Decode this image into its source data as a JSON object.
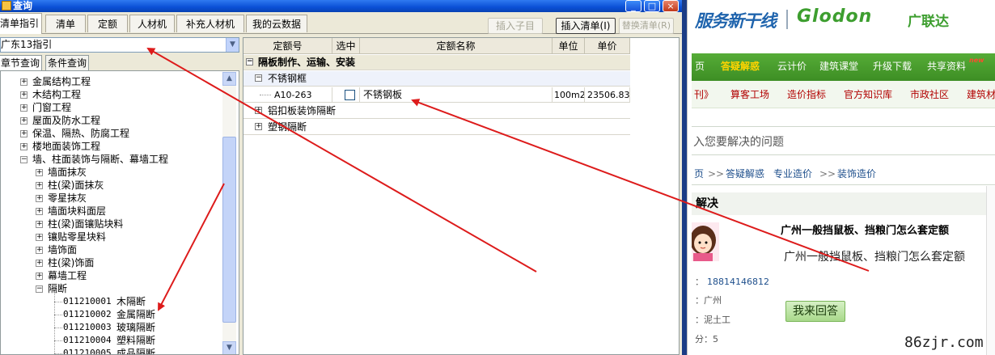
{
  "window": {
    "title": "查询",
    "buttons": {
      "minimize": "_",
      "maximize": "□",
      "close": "×"
    }
  },
  "tabs": [
    "清单指引",
    "清单",
    "定额",
    "人材机",
    "补充人材机",
    "我的云数据"
  ],
  "toolbar": {
    "insert_child": "插入子目",
    "insert_list": "插入清单(I)",
    "replace_list": "替换清单(R)"
  },
  "left_panel": {
    "combo_value": "广东13指引",
    "subtabs": [
      "章节查询",
      "条件查询"
    ],
    "tree": [
      {
        "label": "金属结构工程",
        "expander": "+"
      },
      {
        "label": "木结构工程",
        "expander": "+"
      },
      {
        "label": "门窗工程",
        "expander": "+"
      },
      {
        "label": "屋面及防水工程",
        "expander": "+"
      },
      {
        "label": "保温、隔热、防腐工程",
        "expander": "+"
      },
      {
        "label": "楼地面装饰工程",
        "expander": "+"
      },
      {
        "label": "墙、柱面装饰与隔断、幕墙工程",
        "expander": "−"
      },
      {
        "label": "墙面抹灰",
        "expander": "+"
      },
      {
        "label": "柱(梁)面抹灰",
        "expander": "+"
      },
      {
        "label": "零星抹灰",
        "expander": "+"
      },
      {
        "label": "墙面块料面层",
        "expander": "+"
      },
      {
        "label": "柱(梁)面镶贴块料",
        "expander": "+"
      },
      {
        "label": "镶贴零星块料",
        "expander": "+"
      },
      {
        "label": "墙饰面",
        "expander": "+"
      },
      {
        "label": "柱(梁)饰面",
        "expander": "+"
      },
      {
        "label": "幕墙工程",
        "expander": "+"
      },
      {
        "label": "隔断",
        "expander": "−"
      }
    ],
    "leaf_items": [
      {
        "code": "011210001",
        "name": "木隔断"
      },
      {
        "code": "011210002",
        "name": "金属隔断"
      },
      {
        "code": "011210003",
        "name": "玻璃隔断"
      },
      {
        "code": "011210004",
        "name": "塑料隔断"
      },
      {
        "code": "011210005",
        "name": "成品隔断"
      }
    ]
  },
  "grid": {
    "columns": [
      "定额号",
      "选中",
      "定额名称",
      "单位",
      "单价"
    ],
    "group": {
      "label": "隔板制作、运输、安装",
      "expander": "−"
    },
    "sub_groups": [
      {
        "label": "不锈钢框",
        "expander": "−"
      },
      {
        "label": "铝扣板装饰隔断",
        "expander": "+"
      },
      {
        "label": "塑钢隔断",
        "expander": "+"
      }
    ],
    "row": {
      "code": "A10-263",
      "name": "不锈钢板",
      "unit": "100m2",
      "price": "23506.83"
    }
  },
  "web": {
    "logo_text1": "服务新干线",
    "logo_text2": "Glodon",
    "logo_text3": "广联达",
    "nav": [
      "页",
      "答疑解惑",
      "云计价",
      "建筑课堂",
      "升级下载",
      "共享资料"
    ],
    "nav_new": "new",
    "subnav": [
      "刊》",
      "算客工场",
      "造价指标",
      "官方知识库",
      "市政社区",
      "建筑材"
    ],
    "question_placeholder": "入您要解决的问题",
    "crumbs": [
      "页",
      ">>",
      "答疑解惑",
      "专业造价",
      ">>",
      "装饰造价"
    ],
    "section_title": "解决",
    "question_title": "广州一般挡鼠板、挡粮门怎么套定额",
    "question_desc": "广州一般挡鼠板、挡粮门怎么套定额",
    "meta": [
      {
        "prefix": "：",
        "value": "18814146812"
      },
      {
        "prefix": "：",
        "value": "广州"
      },
      {
        "prefix": "：",
        "value": "泥土工"
      },
      {
        "prefix": "分：",
        "value": "5"
      }
    ],
    "reply_button": "我来回答",
    "watermark": "86zjr.com"
  },
  "colors": {
    "arrow": "#dd1b1b",
    "nav_green": "#4a9f2e",
    "title_blue": "#0a4fd6"
  }
}
